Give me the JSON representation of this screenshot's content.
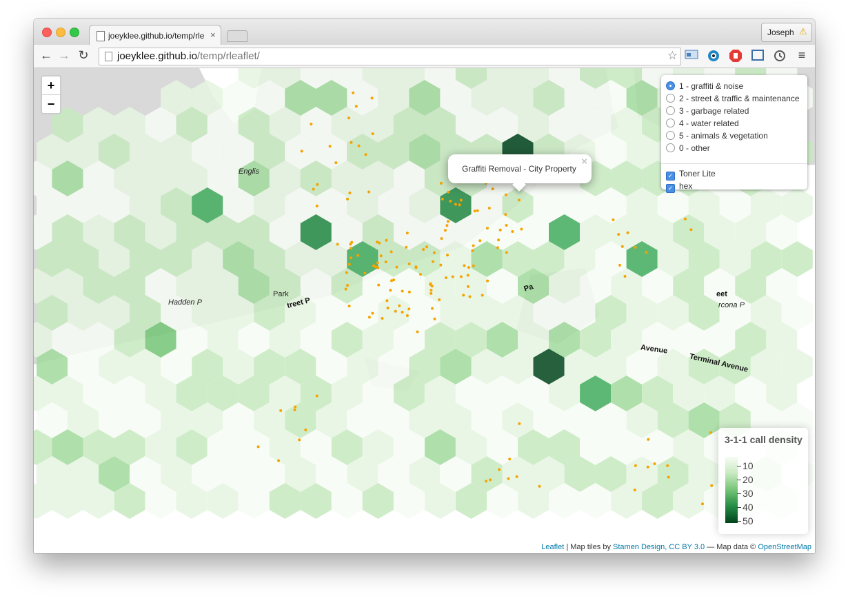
{
  "browser": {
    "tab_title": "joeyklee.github.io/temp/rle",
    "tab_close": "×",
    "profile_name": "Joseph",
    "profile_warning": "⚠",
    "url_host": "joeyklee.github.io",
    "url_path": "/temp/rleaflet/",
    "back_icon": "←",
    "forward_icon": "→",
    "reload_icon": "↻",
    "star_icon": "☆",
    "menu_icon": "≡"
  },
  "map": {
    "zoom_in": "+",
    "zoom_out": "−",
    "popup_text": "Graffiti Removal - City Property",
    "popup_close": "×",
    "labels": {
      "english": "Englis",
      "hadden": "Hadden P",
      "park": "Park",
      "street": "treet P",
      "pa": "Pa",
      "street_right": "eet",
      "strathcona": "rcona P",
      "avenue": "Avenue",
      "terminal": "Terminal Avenue"
    },
    "attribution": {
      "leaflet": "Leaflet",
      "sep": " | Map tiles by ",
      "stamen": "Stamen Design",
      "comma": ", ",
      "license": "CC BY 3.0",
      "dash": " — Map data © ",
      "osm": "OpenStreetMap"
    }
  },
  "layer_control": {
    "base_layers": [
      {
        "label": "1 - graffiti & noise",
        "selected": true
      },
      {
        "label": "2 - street & traffic & maintenance",
        "selected": false
      },
      {
        "label": "3 - garbage related",
        "selected": false
      },
      {
        "label": "4 - water related",
        "selected": false
      },
      {
        "label": "5 - animals & vegetation",
        "selected": false
      },
      {
        "label": "0 - other",
        "selected": false
      }
    ],
    "overlays": [
      {
        "label": "Toner Lite",
        "checked": true
      },
      {
        "label": "hex",
        "checked": true
      }
    ]
  },
  "legend": {
    "title": "3-1-1 call density",
    "ticks": [
      "10",
      "20",
      "30",
      "40",
      "50"
    ],
    "colors": [
      "#f7fcf5",
      "#c7e9c0",
      "#74c476",
      "#238b45",
      "#00441b"
    ]
  },
  "colors": {
    "point": "#f5a300",
    "water": "#d9d9d9"
  }
}
